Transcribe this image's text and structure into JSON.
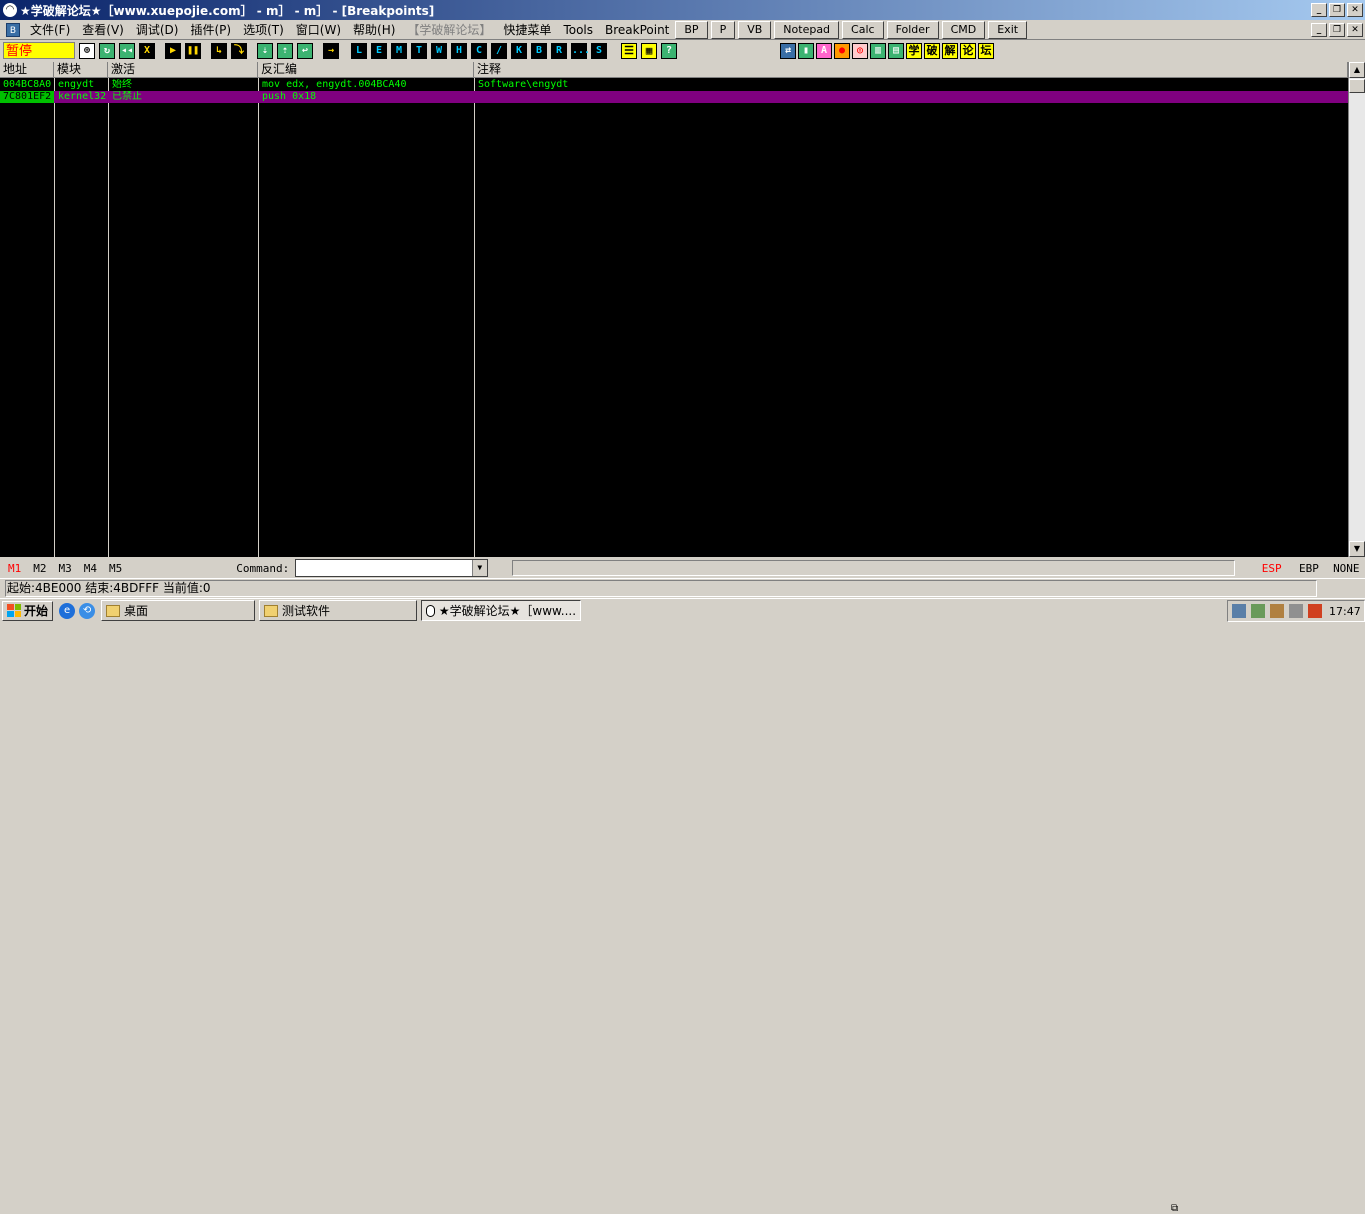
{
  "window": {
    "title": "★学破解论坛★［www.xuepojie.com］ - m］ - m］ - [Breakpoints]"
  },
  "menu": {
    "items": [
      "文件(F)",
      "查看(V)",
      "调试(D)",
      "插件(P)",
      "选项(T)",
      "窗口(W)",
      "帮助(H)"
    ],
    "disabled_item": "【学破解论坛】",
    "extra_items": [
      "快捷菜单",
      "Tools",
      "BreakPoint"
    ],
    "buttons": [
      "BP",
      "P",
      "VB",
      "Notepad",
      "Calc",
      "Folder",
      "CMD",
      "Exit"
    ]
  },
  "toolbar": {
    "status": "暂停",
    "letter_buttons": [
      "L",
      "E",
      "M",
      "T",
      "W",
      "H",
      "C",
      "/",
      "K",
      "B",
      "R",
      "...",
      "S"
    ],
    "yellow_buttons": [
      "学",
      "破",
      "解",
      "论",
      "坛"
    ]
  },
  "breakpoints": {
    "headers": [
      "地址",
      "模块",
      "激活",
      "反汇编",
      "注释"
    ],
    "rows": [
      {
        "address": "004BC8A0",
        "module": "engydt",
        "active": "始终",
        "disasm": "mov edx, engydt.004BCA40",
        "comment": "Software\\engydt"
      },
      {
        "address": "7C801EF2",
        "module": "kernel32",
        "active": "已禁止",
        "disasm": "push 0x18",
        "comment": ""
      }
    ]
  },
  "command_bar": {
    "tabs": [
      "M1",
      "M2",
      "M3",
      "M4",
      "M5"
    ],
    "label": "Command:",
    "input_value": "",
    "registers": [
      "ESP",
      "EBP",
      "NONE"
    ]
  },
  "status_bar": {
    "text": "起始:4BE000 结束:4BDFFF 当前值:0"
  },
  "taskbar": {
    "start_label": "开始",
    "tasks": [
      "桌面",
      "测试软件",
      "★学破解论坛★［www...."
    ],
    "clock": "17:47"
  },
  "colors": {
    "accent": "#0a246a",
    "text_green": "#00ff00",
    "disabled_row": "#800080",
    "highlight_red": "#ff0000"
  }
}
